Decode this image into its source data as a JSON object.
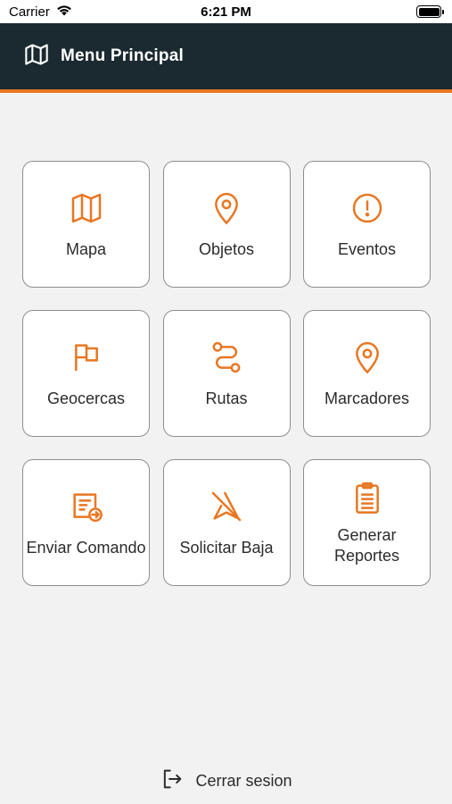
{
  "status_bar": {
    "carrier": "Carrier",
    "time": "6:21 PM"
  },
  "header": {
    "title": "Menu Principal",
    "icon": "map-icon"
  },
  "menu": {
    "items": [
      {
        "label": "Mapa",
        "icon": "map-icon"
      },
      {
        "label": "Objetos",
        "icon": "location-pin-icon"
      },
      {
        "label": "Eventos",
        "icon": "alert-circle-icon"
      },
      {
        "label": "Geocercas",
        "icon": "flag-icon"
      },
      {
        "label": "Rutas",
        "icon": "route-icon"
      },
      {
        "label": "Marcadores",
        "icon": "location-pin-icon"
      },
      {
        "label": "Enviar Comando",
        "icon": "send-command-icon"
      },
      {
        "label": "Solicitar Baja",
        "icon": "navigation-off-icon"
      },
      {
        "label": "Generar Reportes",
        "icon": "clipboard-icon"
      }
    ]
  },
  "logout": {
    "label": "Cerrar sesion",
    "icon": "logout-icon"
  },
  "colors": {
    "accent": "#e87722",
    "header_bg": "#1b2a30",
    "background": "#f2f2f2"
  }
}
